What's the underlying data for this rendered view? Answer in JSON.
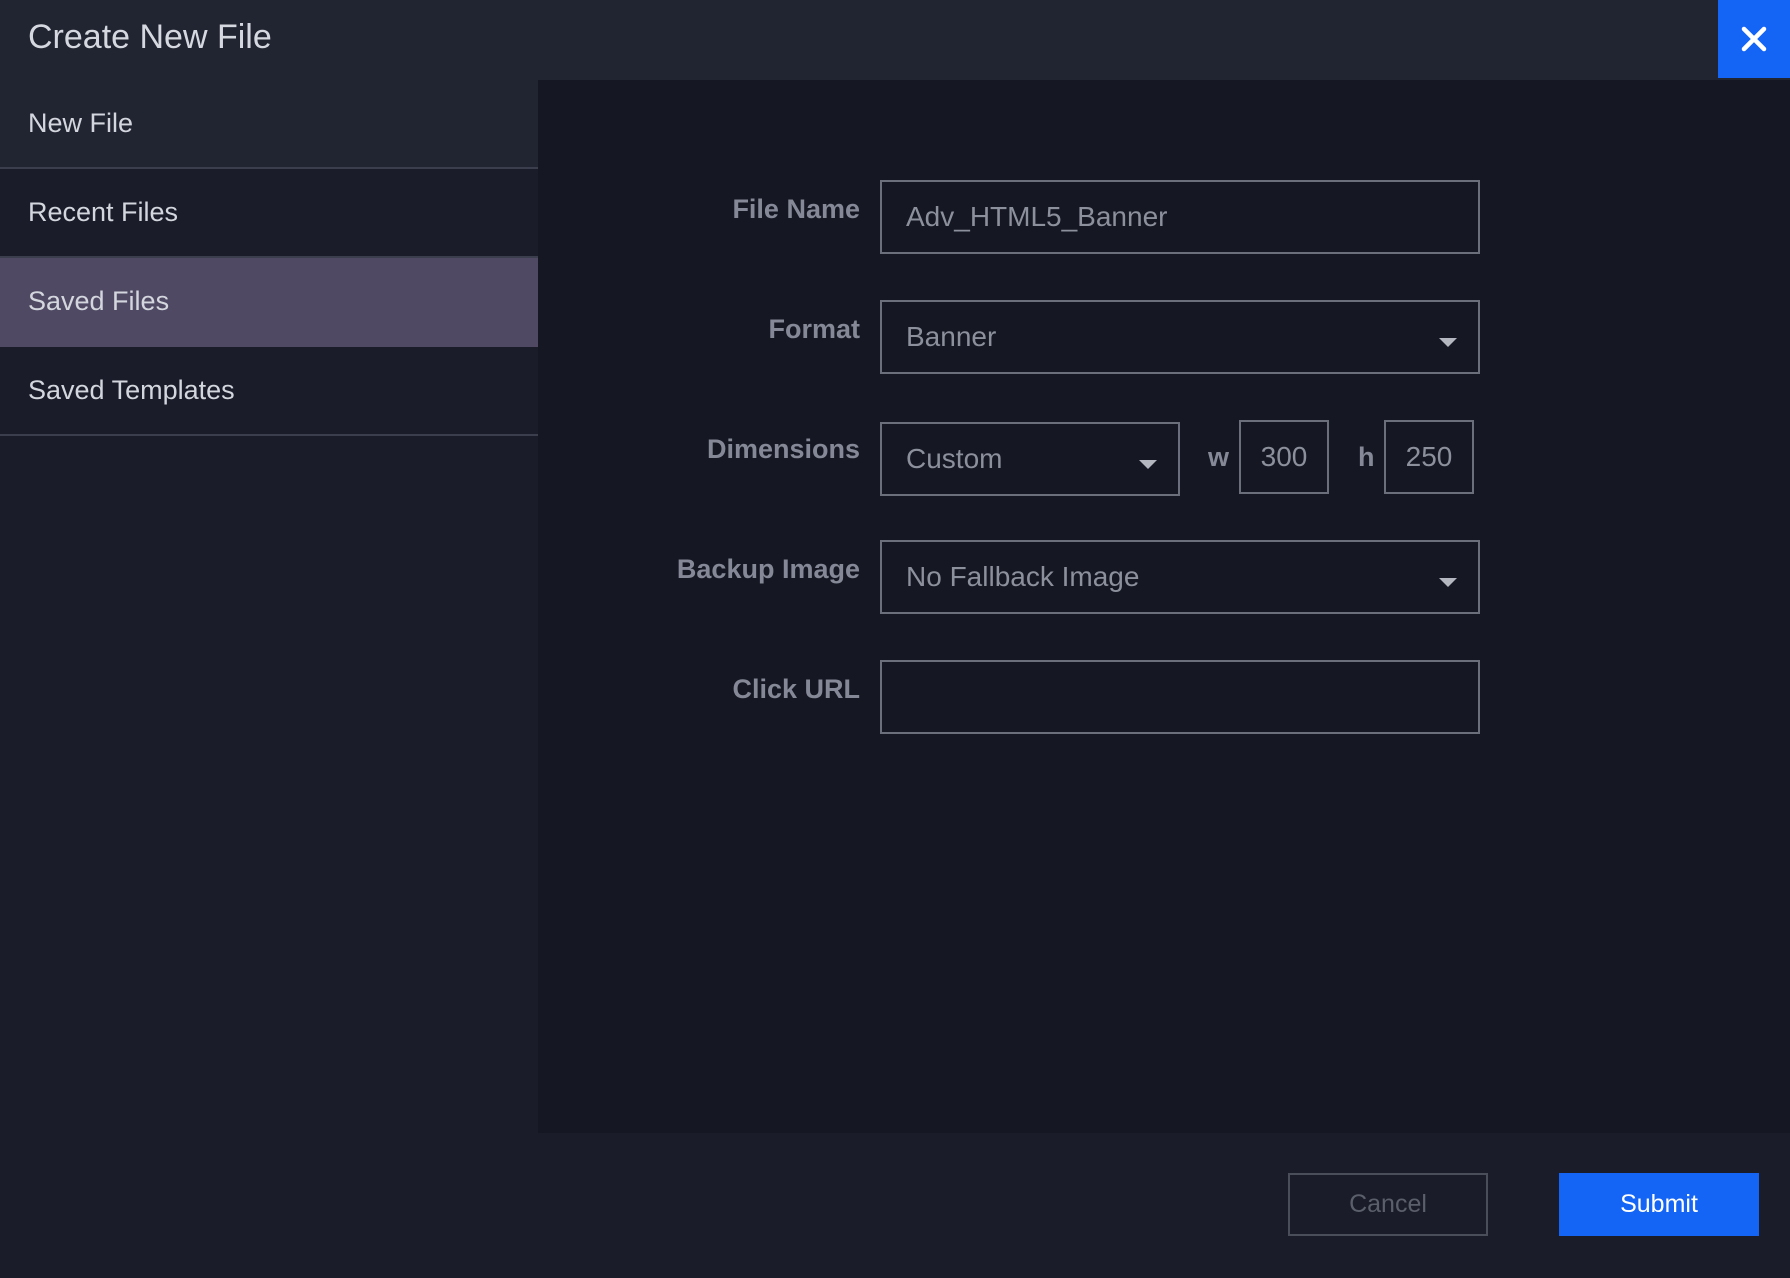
{
  "header": {
    "title": "Create New File",
    "close_icon": "close-icon"
  },
  "sidebar": {
    "items": [
      {
        "label": "New File",
        "selected": false
      },
      {
        "label": "Recent Files",
        "selected": false
      },
      {
        "label": "Saved Files",
        "selected": true
      },
      {
        "label": "Saved Templates",
        "selected": false
      }
    ]
  },
  "form": {
    "file_name": {
      "label": "File Name",
      "value": "Adv_HTML5_Banner"
    },
    "format": {
      "label": "Format",
      "value": "Banner"
    },
    "dimensions": {
      "label": "Dimensions",
      "preset": "Custom",
      "w_label": "w",
      "w_value": "300",
      "h_label": "h",
      "h_value": "250"
    },
    "backup_image": {
      "label": "Backup Image",
      "value": "No Fallback Image"
    },
    "click_url": {
      "label": "Click URL",
      "value": ""
    }
  },
  "footer": {
    "cancel_label": "Cancel",
    "submit_label": "Submit"
  },
  "colors": {
    "accent": "#1464f6",
    "selected_item": "#4f4964",
    "background": "#1a1d29",
    "panel": "#151823"
  }
}
